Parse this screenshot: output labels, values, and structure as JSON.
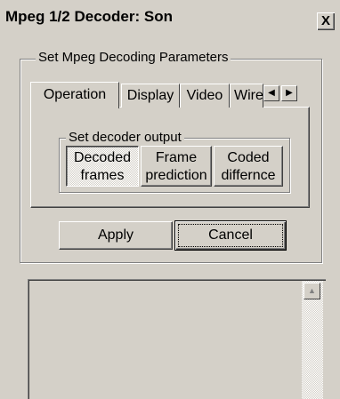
{
  "window": {
    "title": "Mpeg 1/2 Decoder: Son",
    "close_glyph": "X"
  },
  "params_group": {
    "label": "Set Mpeg Decoding Parameters",
    "tabs": [
      {
        "label": "Operation",
        "active": true
      },
      {
        "label": "Display",
        "active": false
      },
      {
        "label": "Video",
        "active": false
      },
      {
        "label": "Wire",
        "active": false
      }
    ],
    "tab_scroll_left": "◀",
    "tab_scroll_right": "▶"
  },
  "output_group": {
    "label": "Set decoder output",
    "buttons": [
      {
        "line1": "Decoded",
        "line2": "frames",
        "pressed": true
      },
      {
        "line1": "Frame",
        "line2": "prediction",
        "pressed": false
      },
      {
        "line1": "Coded",
        "line2": "differnce",
        "pressed": false
      }
    ]
  },
  "actions": {
    "apply_label": "Apply",
    "cancel_label": "Cancel"
  },
  "log_area": {
    "scroll_up_glyph": "▲"
  },
  "colors": {
    "face": "#d4d0c8",
    "highlight": "#ffffff",
    "shadow": "#808080",
    "dark_shadow": "#404040"
  }
}
